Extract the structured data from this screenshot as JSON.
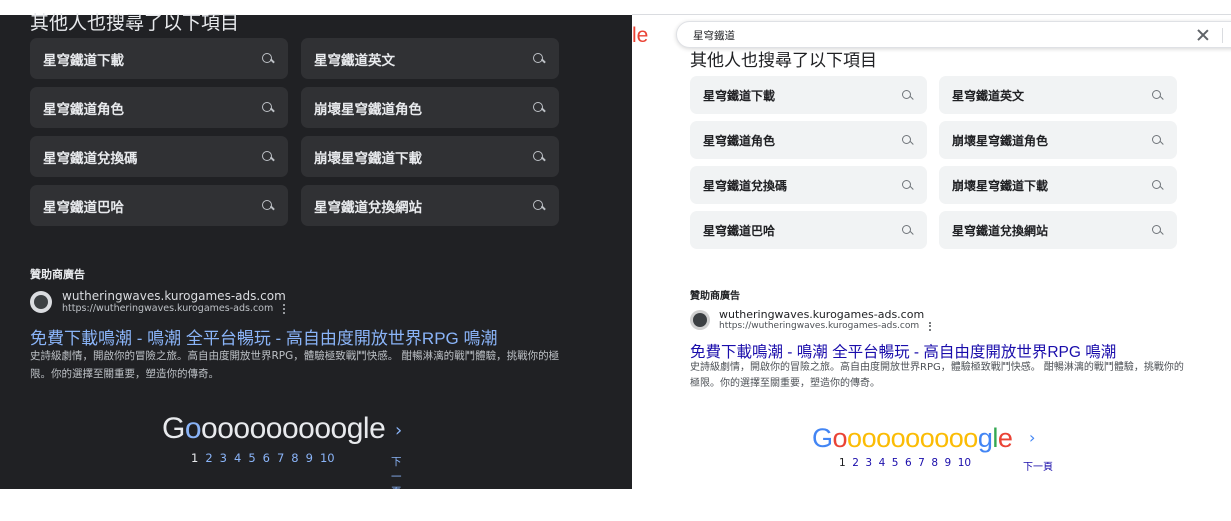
{
  "related_heading": "其他人也搜尋了以下項目",
  "related_searches": [
    "星穹鐵道下載",
    "星穹鐵道英文",
    "星穹鐵道角色",
    "崩壞星穹鐵道角色",
    "星穹鐵道兌換碼",
    "崩壞星穹鐵道下載",
    "星穹鐵道巴哈",
    "星穹鐵道兌換網站"
  ],
  "search": {
    "query": "星穹鐵道"
  },
  "logo_peek": "le",
  "ad": {
    "sponsored_label": "贊助商廣告",
    "domain": "wutheringwaves.kurogames-ads.com",
    "url": "https://wutheringwaves.kurogames-ads.com",
    "title": "免費下載鳴潮 - 鳴潮 全平台暢玩 - 高自由度開放世界RPG 鳴潮",
    "description": "史詩級劇情，開啟你的冒險之旅。高自由度開放世界RPG，體驗極致戰鬥快感。 酣暢淋漓的戰鬥體驗，挑戰你的極限。你的選擇至關重要，塑造你的傳奇。"
  },
  "pagination": {
    "wordmark": [
      "G",
      "o",
      "o",
      "o",
      "o",
      "o",
      "o",
      "o",
      "o",
      "o",
      "o",
      "g",
      "l",
      "e"
    ],
    "pages": [
      "1",
      "2",
      "3",
      "4",
      "5",
      "6",
      "7",
      "8",
      "9",
      "10"
    ],
    "current_page": "1",
    "next_icon": "›",
    "next_label": "下一頁"
  },
  "theme": {
    "dark_bg": "#202124",
    "dark_chip": "#303134",
    "dark_link": "#8ab4f8",
    "light_link": "#1a0dab",
    "google_blue": "#4285f4",
    "google_red": "#ea4335",
    "google_yellow": "#fbbc05",
    "google_green": "#34a853"
  },
  "icons": {
    "chip_icon": "search-icon",
    "clear_icon": "close-icon",
    "ad_menu_icon": "more-vert-icon",
    "favicon": "wuthering-waves-favicon"
  }
}
